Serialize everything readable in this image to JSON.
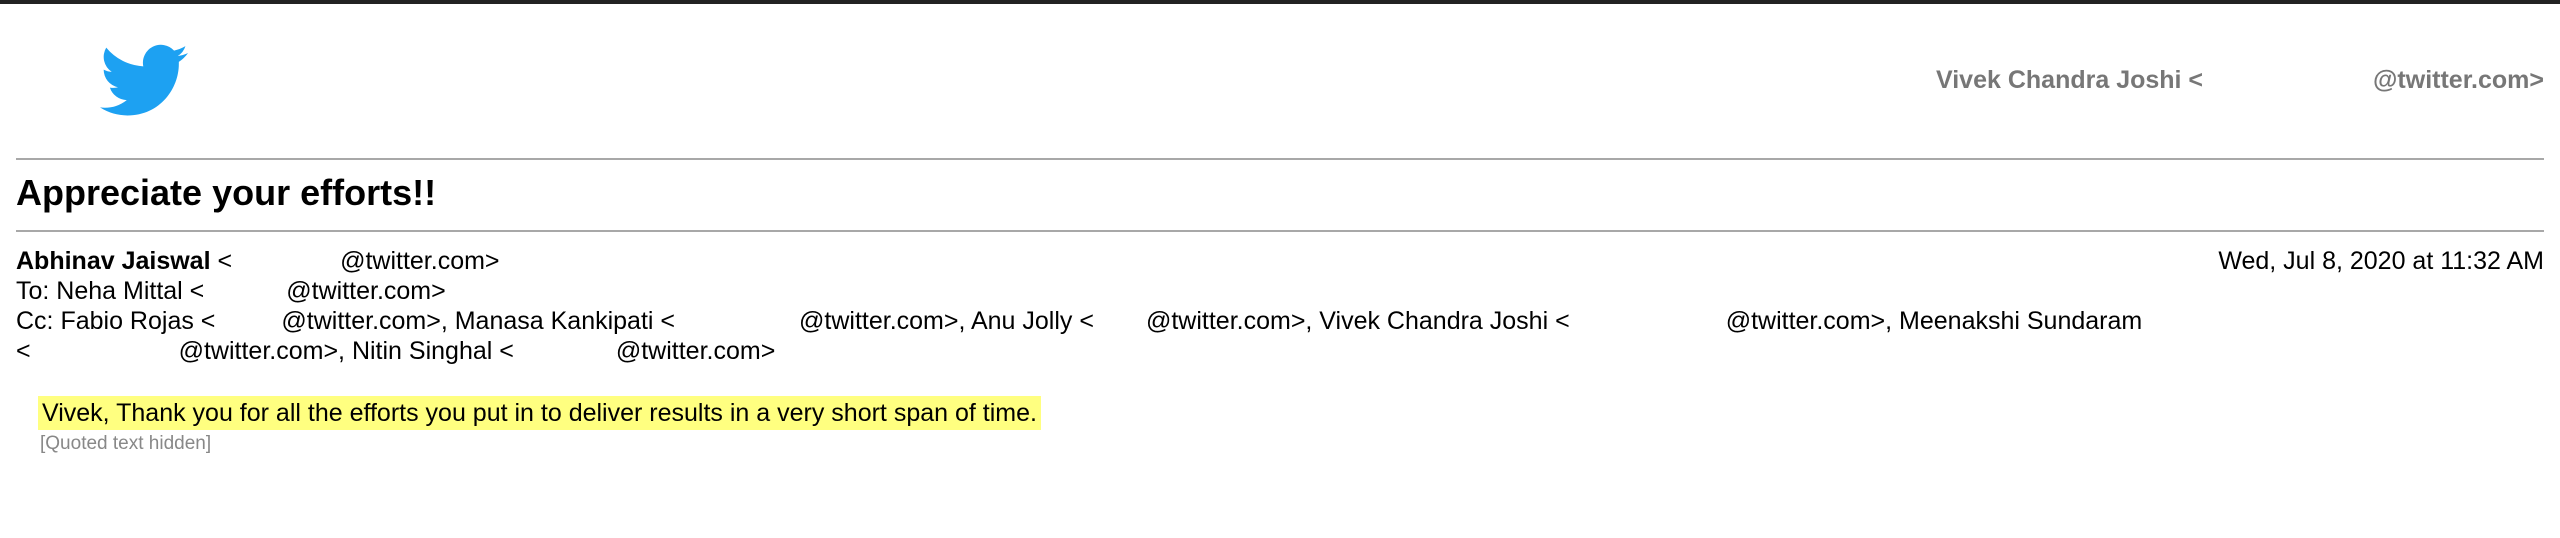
{
  "header": {
    "logo_icon": "twitter-bird-icon",
    "brand_color": "#1da1f2",
    "account_name": "Vivek Chandra Joshi <",
    "account_domain": "@twitter.com>"
  },
  "email": {
    "subject": "Appreciate your efforts!!",
    "from_name": "Abhinav Jaiswal",
    "from_open": " <",
    "from_domain": "@twitter.com>",
    "date": "Wed, Jul 8, 2020 at 11:32 AM",
    "to_prefix": "To: Neha Mittal <",
    "to_domain": "@twitter.com>",
    "cc_line1": {
      "prefix": "Cc: Fabio Rojas <",
      "part1": "@twitter.com>, Manasa Kankipati <",
      "part2": "@twitter.com>, Anu Jolly <",
      "part3": "@twitter.com>, Vivek Chandra Joshi <",
      "part4": "@twitter.com>, Meenakshi Sundaram"
    },
    "cc_line2": {
      "prefix": "<",
      "part1": "@twitter.com>, Nitin Singhal <",
      "part2": "@twitter.com>"
    },
    "body": "Vivek, Thank you for all the efforts you put in to deliver results in a very short span of time.",
    "highlight_color": "#ffff80",
    "quoted_text": "[Quoted text hidden]"
  }
}
